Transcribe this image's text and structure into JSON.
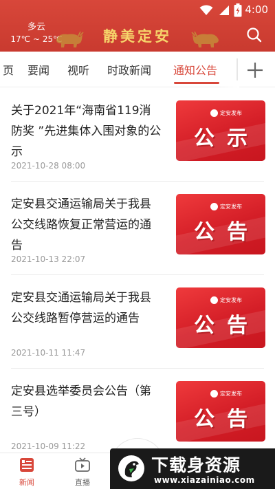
{
  "status_bar": {
    "time": "4:00"
  },
  "header": {
    "weather_condition": "多云",
    "weather_temp": "17℃ ~ 25℃",
    "app_title": "静美定安"
  },
  "tabs": [
    {
      "label": "页",
      "active": false
    },
    {
      "label": "要闻",
      "active": false
    },
    {
      "label": "视听",
      "active": false
    },
    {
      "label": "时政新闻",
      "active": false
    },
    {
      "label": "通知公告",
      "active": true
    }
  ],
  "news": [
    {
      "title": "关于2021年“海南省119消防奖 ”先进集体入围对象的公示",
      "date": "2021-10-28 08:00",
      "thumb": {
        "logo_text": "定安发布",
        "text": "公示"
      }
    },
    {
      "title": "定安县交通运输局关于我县公交线路恢复正常营运的通告",
      "date": "2021-10-13 22:07",
      "thumb": {
        "logo_text": "定安发布",
        "text": "公告"
      }
    },
    {
      "title": "定安县交通运输局关于我县公交线路暂停营运的通告",
      "date": "2021-10-11 11:47",
      "thumb": {
        "logo_text": "定安发布",
        "text": "公告"
      }
    },
    {
      "title": "定安县选举委员会公告（第三号）",
      "date": "2021-10-09 11:22",
      "thumb": {
        "logo_text": "定安发布",
        "text": "公告"
      }
    }
  ],
  "bottom_nav": [
    {
      "label": "新闻",
      "icon": "news-icon",
      "active": true
    },
    {
      "label": "直播",
      "icon": "tv-icon",
      "active": false
    }
  ],
  "watermark": {
    "title": "下载身资源",
    "url": "www.xiazainiao.com"
  },
  "colors": {
    "brand_red": "#d8473a",
    "title_gold": "#f6d56b",
    "thumb_red": "#d41e27"
  }
}
